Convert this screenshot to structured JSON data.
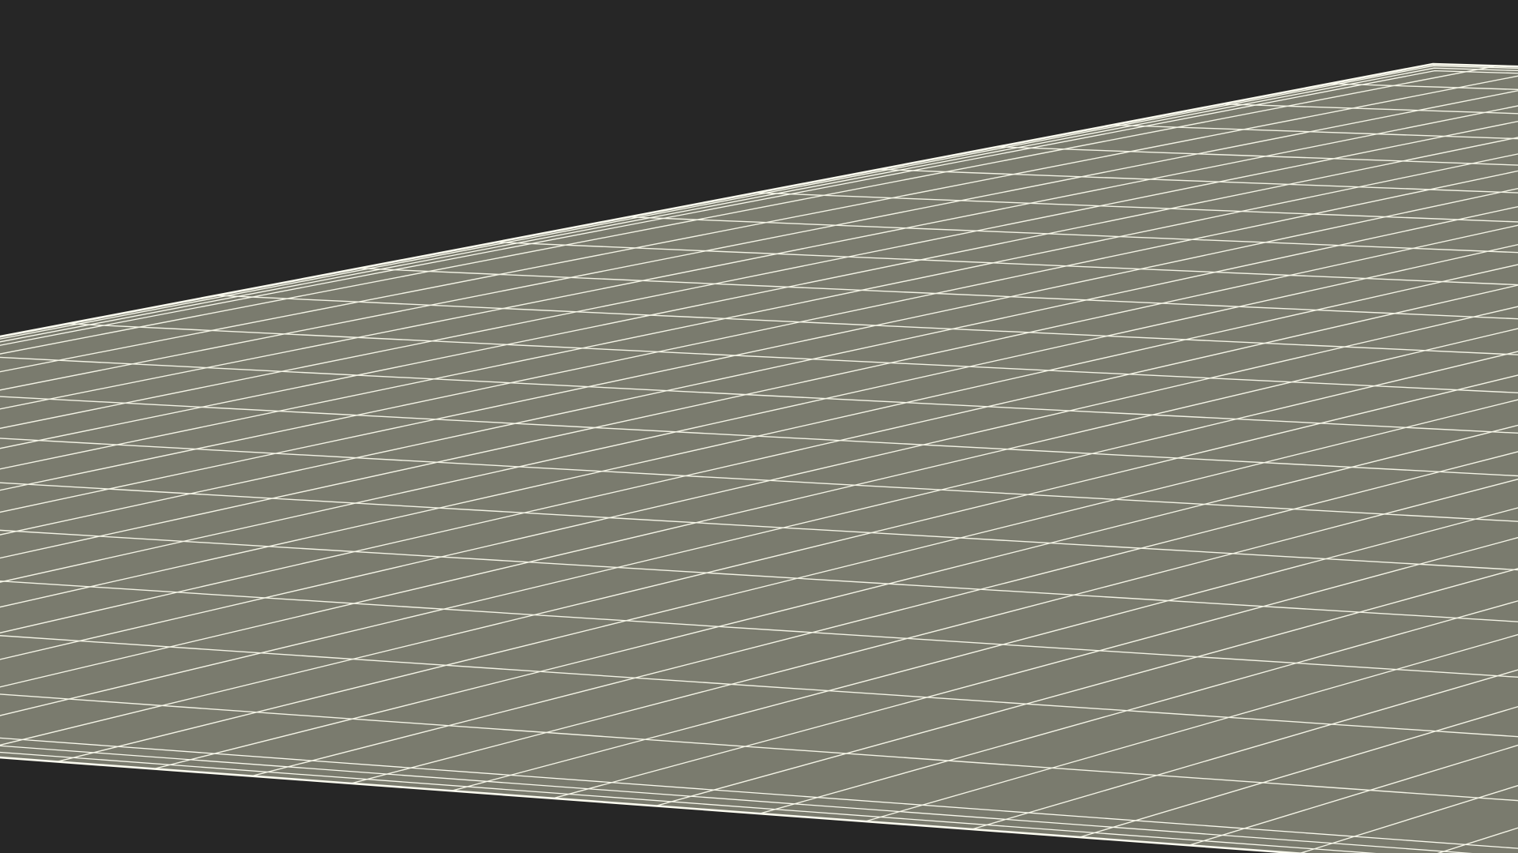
{
  "scene": {
    "object_name": "mesh-plane",
    "render_mode": "wireframe-on-shaded",
    "grid_subdivisions": {
      "u": 34,
      "v": 20
    },
    "edge_bevel_rings": 3,
    "colors": {
      "background": "#262626",
      "surface": "#7a7b6e",
      "wire": "#f4f4e6",
      "edge_highlight": "#fbfbef"
    }
  }
}
